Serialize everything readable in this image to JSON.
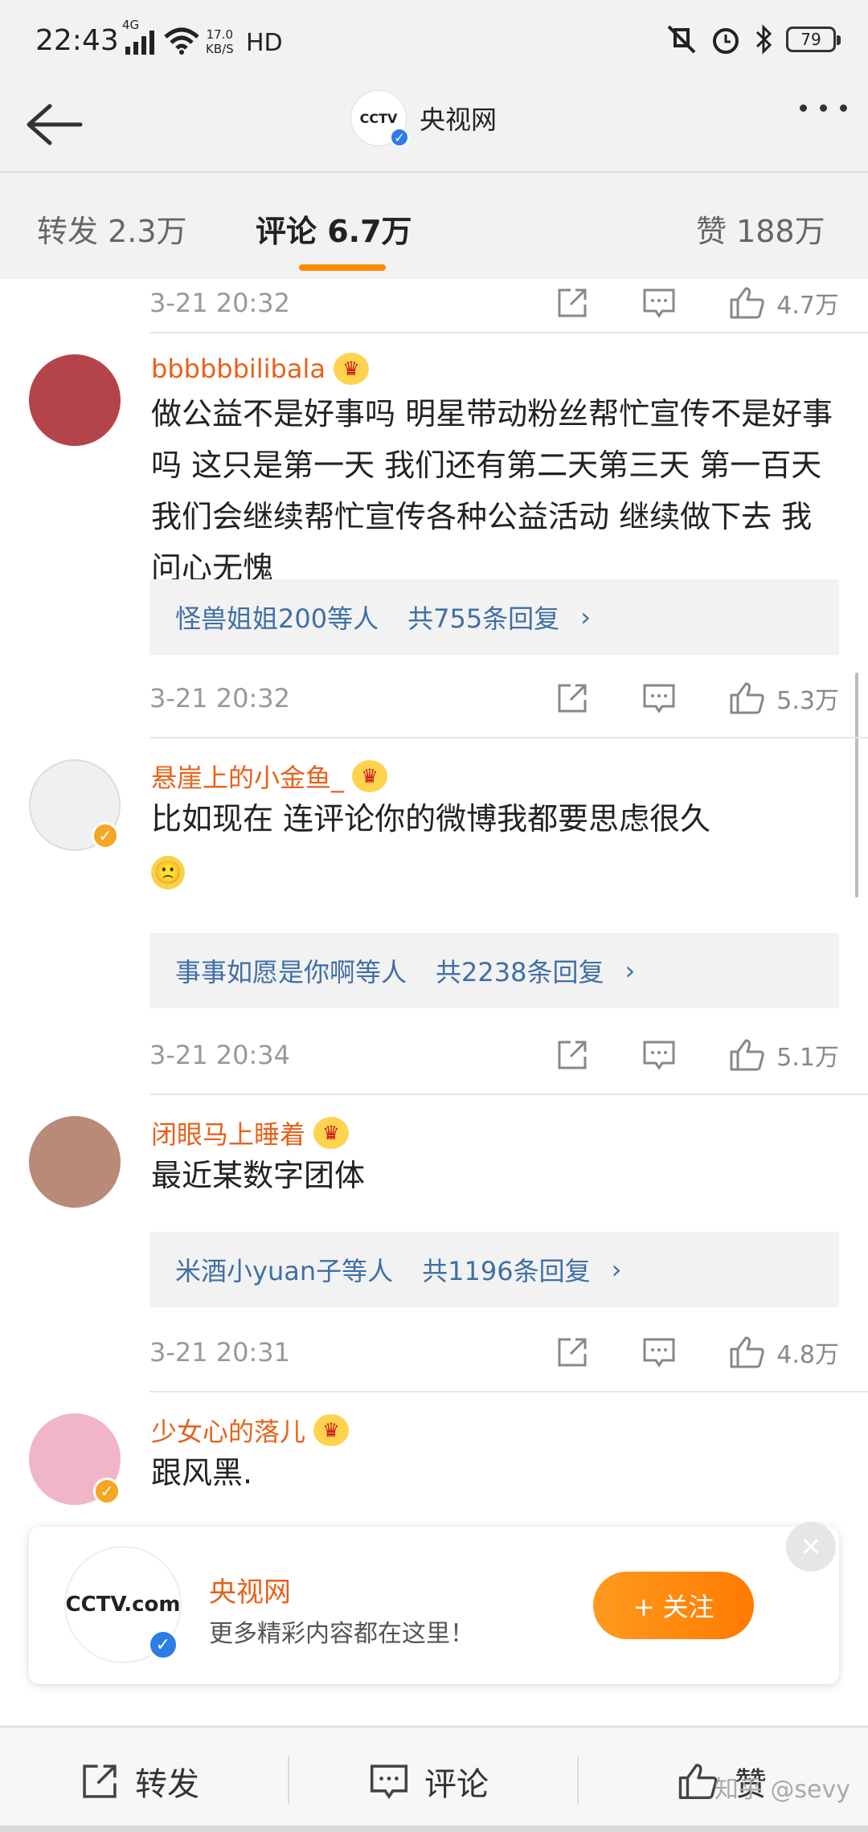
{
  "status_bar": {
    "time": "22:43",
    "network": "4G",
    "speed_value": "17.0",
    "speed_unit": "KB/S",
    "hd": "HD",
    "battery": "79"
  },
  "nav": {
    "title": "央视网",
    "avatar_text": "CCTV"
  },
  "tabs": {
    "repost": "转发 2.3万",
    "comments": "评论 6.7万",
    "likes": "赞 188万"
  },
  "comments": [
    {
      "time": "3-21 20:32",
      "likes": "4.7万"
    },
    {
      "username": "bbbbbbilibala",
      "text": "做公益不是好事吗 明星带动粉丝帮忙宣传不是好事吗 这只是第一天 我们还有第二天第三天 第一百天 我们会继续帮忙宣传各种公益活动 继续做下去 我问心无愧",
      "replies_by": "怪兽姐姐200等人",
      "replies_count": "共755条回复",
      "time": "3-21 20:32",
      "likes": "5.3万",
      "avatar_color": "#b5434a"
    },
    {
      "username": "悬崖上的小金鱼_",
      "text": "比如现在 连评论你的微博我都要思虑很久",
      "emoji": "🙁",
      "replies_by": "事事如愿是你啊等人",
      "replies_count": "共2238条回复",
      "time": "3-21 20:34",
      "likes": "5.1万"
    },
    {
      "username": "闭眼马上睡着",
      "text": "最近某数字团体",
      "replies_by": "米酒小yuan子等人",
      "replies_count": "共1196条回复",
      "time": "3-21 20:31",
      "likes": "4.8万"
    },
    {
      "username": "少女心的落儿",
      "text": "跟风黑."
    }
  ],
  "promo": {
    "name": "央视网",
    "subtitle": "更多精彩内容都在这里！",
    "follow_label": "+ 关注",
    "logo_text": "CCTV.com"
  },
  "bottom_bar": {
    "repost": "转发",
    "comment": "评论",
    "like": "赞"
  },
  "watermark": "知乎 @sevy",
  "colors": {
    "username": "#e8611a",
    "reply_link": "#3f6fa6",
    "accent": "#ff8a00",
    "verified_blue": "#2d7de6",
    "verified_gold": "#f5a623"
  }
}
